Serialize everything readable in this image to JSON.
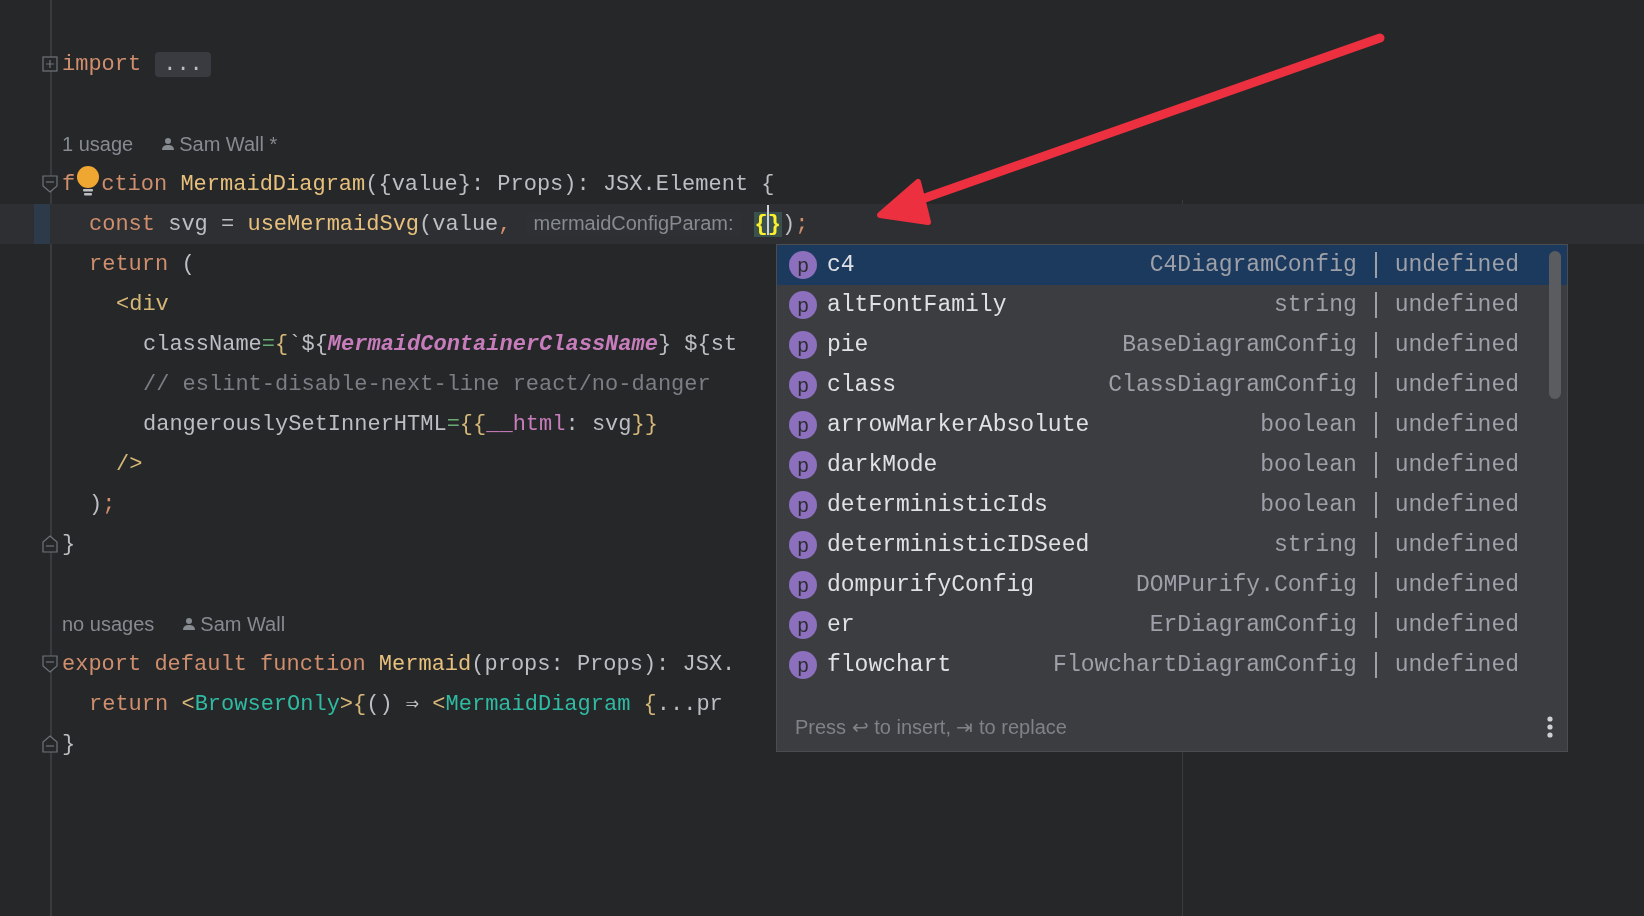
{
  "editor": {
    "lines": [
      {
        "kind": "folded",
        "current": false,
        "tokens": [
          {
            "t": "import",
            "kind": "keyword"
          },
          {
            "t": "...",
            "kind": "folded"
          }
        ]
      },
      {
        "kind": "blank"
      },
      {
        "kind": "meta",
        "usage": "1 usage",
        "author": "Sam Wall *"
      },
      {
        "kind": "fold-start",
        "current": false,
        "tokens": [
          {
            "t": "f",
            "kind": "keyword"
          },
          {
            "kind": "bulb"
          },
          {
            "t": "ction",
            "kind": "keyword"
          },
          {
            "t": " MermaidDiagram",
            "kind": "fn"
          },
          {
            "t": "({value}: Props): JSX.Element {",
            "kind": "plain"
          }
        ],
        "children": [
          {
            "kind": "code",
            "current": true,
            "tokens": [
              {
                "t": "const",
                "kind": "keyword"
              },
              {
                "t": " svg = ",
                "kind": "plain"
              },
              {
                "t": "useMermaidSvg",
                "kind": "fn"
              },
              {
                "t": "(value",
                "kind": "plain"
              },
              {
                "t": ",",
                "kind": "keyword"
              },
              {
                "t": "mermaidConfigParam:",
                "kind": "hint"
              },
              {
                "t": "{}",
                "kind": "matched"
              },
              {
                "t": ")",
                "kind": "plain"
              },
              {
                "t": ";",
                "kind": "keyword"
              }
            ]
          },
          {
            "kind": "code",
            "current": false,
            "tokens": [
              {
                "t": "return",
                "kind": "keyword"
              },
              {
                "t": " (",
                "kind": "plain"
              }
            ],
            "children": [
              {
                "kind": "code",
                "current": false,
                "tokens": [
                  {
                    "t": "<div",
                    "kind": "tag"
                  }
                ],
                "children": [
                  {
                    "kind": "code",
                    "current": false,
                    "tokens": [
                      {
                        "t": "className",
                        "kind": "plain"
                      },
                      {
                        "t": "=",
                        "kind": "eq"
                      },
                      {
                        "t": "{",
                        "kind": "brace"
                      },
                      {
                        "t": "`${",
                        "kind": "plain"
                      },
                      {
                        "t": "MermaidContainerClassName",
                        "kind": "constant"
                      },
                      {
                        "t": "} ${st",
                        "kind": "plain"
                      }
                    ]
                  },
                  {
                    "kind": "code",
                    "current": false,
                    "tokens": [
                      {
                        "t": "// eslint-disable-next-line react/no-danger",
                        "kind": "comment"
                      }
                    ]
                  },
                  {
                    "kind": "code",
                    "current": false,
                    "tokens": [
                      {
                        "t": "dangerouslySetInnerHTML",
                        "kind": "plain"
                      },
                      {
                        "t": "=",
                        "kind": "eq"
                      },
                      {
                        "t": "{{",
                        "kind": "brace"
                      },
                      {
                        "t": "__html",
                        "kind": "field"
                      },
                      {
                        "t": ": svg",
                        "kind": "plain"
                      },
                      {
                        "t": "}}",
                        "kind": "brace"
                      }
                    ]
                  }
                ]
              },
              {
                "kind": "code",
                "current": false,
                "tokens": [
                  {
                    "t": "/>",
                    "kind": "tag"
                  }
                ]
              }
            ]
          },
          {
            "kind": "code",
            "current": false,
            "tokens": [
              {
                "t": ")",
                "kind": "plain"
              },
              {
                "t": ";",
                "kind": "keyword"
              }
            ]
          }
        ]
      },
      {
        "kind": "fold-end",
        "current": false,
        "tokens": [
          {
            "t": "}",
            "kind": "plain"
          }
        ]
      },
      {
        "kind": "blank"
      },
      {
        "kind": "meta",
        "usage": "no usages",
        "author": "Sam Wall"
      },
      {
        "kind": "fold-start",
        "current": false,
        "tokens": [
          {
            "t": "export default function",
            "kind": "keyword"
          },
          {
            "t": " Mermaid",
            "kind": "fn"
          },
          {
            "t": "(props: Props): JSX.",
            "kind": "plain"
          }
        ],
        "children": [
          {
            "kind": "code",
            "current": false,
            "tokens": [
              {
                "t": "return",
                "kind": "keyword"
              },
              {
                "t": " <",
                "kind": "tag"
              },
              {
                "t": "BrowserOnly",
                "kind": "component"
              },
              {
                "t": ">",
                "kind": "tag"
              },
              {
                "t": "{",
                "kind": "brace"
              },
              {
                "t": "() ⇒ ",
                "kind": "plain"
              },
              {
                "t": "<",
                "kind": "tag"
              },
              {
                "t": "MermaidDiagram",
                "kind": "component"
              },
              {
                "t": " {",
                "kind": "brace"
              },
              {
                "t": "...pr",
                "kind": "plain"
              }
            ]
          }
        ]
      },
      {
        "kind": "fold-end",
        "current": false,
        "tokens": [
          {
            "t": "}",
            "kind": "plain"
          }
        ]
      }
    ]
  },
  "completion": {
    "items": [
      {
        "badge": "p",
        "name": "c4",
        "type": "C4DiagramConfig",
        "extra": "undefined",
        "selected": true
      },
      {
        "badge": "p",
        "name": "altFontFamily",
        "type": "string",
        "extra": "undefined",
        "selected": false
      },
      {
        "badge": "p",
        "name": "pie",
        "type": "BaseDiagramConfig",
        "extra": "undefined",
        "selected": false
      },
      {
        "badge": "p",
        "name": "class",
        "type": "ClassDiagramConfig",
        "extra": "undefined",
        "selected": false
      },
      {
        "badge": "p",
        "name": "arrowMarkerAbsolute",
        "type": "boolean",
        "extra": "undefined",
        "selected": false
      },
      {
        "badge": "p",
        "name": "darkMode",
        "type": "boolean",
        "extra": "undefined",
        "selected": false
      },
      {
        "badge": "p",
        "name": "deterministicIds",
        "type": "boolean",
        "extra": "undefined",
        "selected": false
      },
      {
        "badge": "p",
        "name": "deterministicIDSeed",
        "type": "string",
        "extra": "undefined",
        "selected": false
      },
      {
        "badge": "p",
        "name": "dompurifyConfig",
        "type": "DOMPurify.Config",
        "extra": "undefined",
        "selected": false
      },
      {
        "badge": "p",
        "name": "er",
        "type": "ErDiagramConfig",
        "extra": "undefined",
        "selected": false
      },
      {
        "badge": "p",
        "name": "flowchart",
        "type": "FlowchartDiagramConfig",
        "extra": "undefined",
        "selected": false
      }
    ],
    "footer": "Press ↩ to insert, ⇥ to replace"
  }
}
